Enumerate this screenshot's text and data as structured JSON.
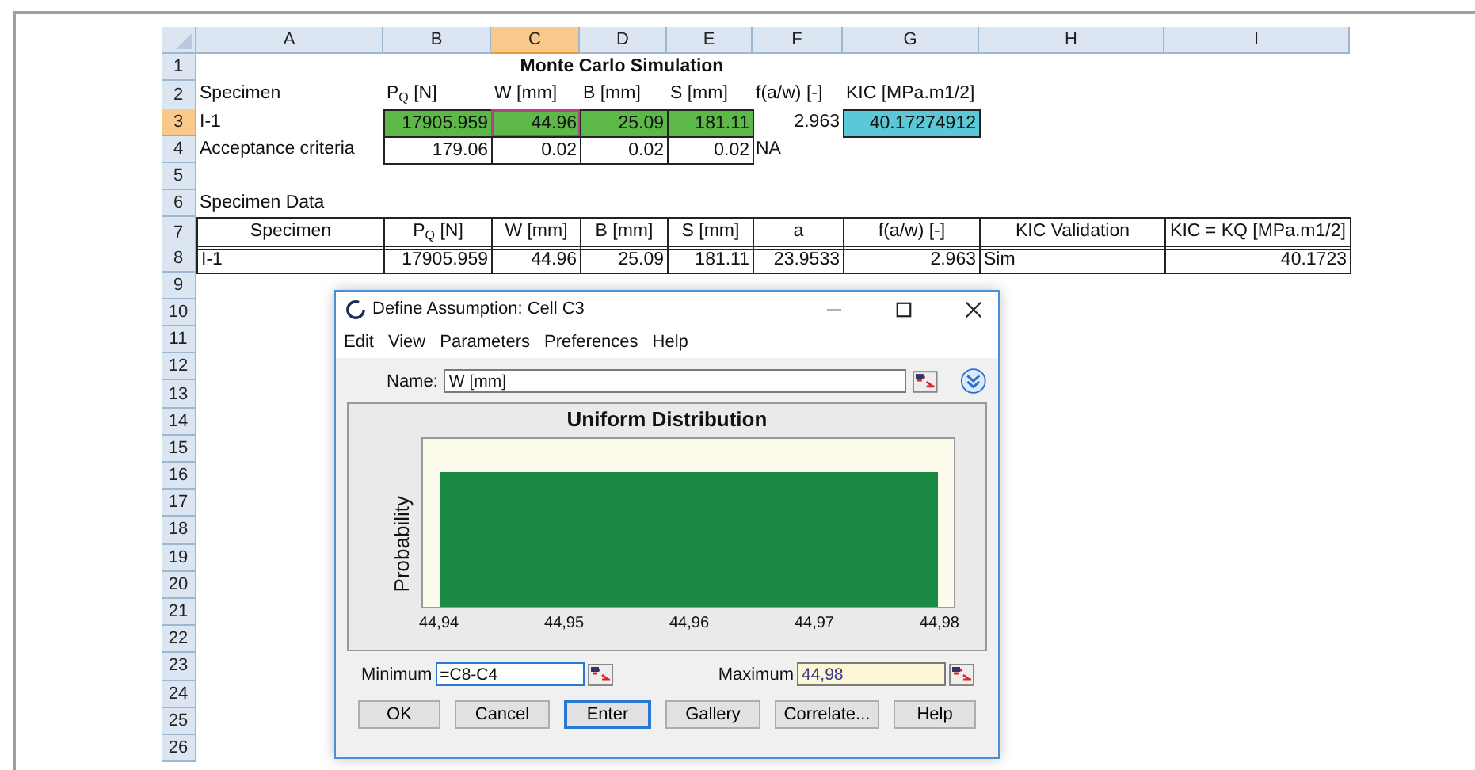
{
  "sheet": {
    "columns": [
      {
        "label": "A",
        "selected": false
      },
      {
        "label": "B",
        "selected": false
      },
      {
        "label": "C",
        "selected": true
      },
      {
        "label": "D",
        "selected": false
      },
      {
        "label": "E",
        "selected": false
      },
      {
        "label": "F",
        "selected": false
      },
      {
        "label": "G",
        "selected": false
      },
      {
        "label": "H",
        "selected": false
      },
      {
        "label": "I",
        "selected": false
      }
    ],
    "rows": [
      {
        "label": "1",
        "selected": false,
        "cells": [
          null,
          null,
          {
            "text": "Monte Carlo Simulation",
            "kind": "title"
          }
        ]
      },
      {
        "label": "2",
        "selected": false,
        "cells": [
          {
            "text": "Specimen",
            "kind": "text"
          },
          {
            "text": "P$_{Q}$ [N]",
            "kind": "text"
          },
          {
            "text": "W [mm]",
            "kind": "text"
          },
          {
            "text": "B [mm]",
            "kind": "text"
          },
          {
            "text": "S [mm]",
            "kind": "text"
          },
          {
            "text": "f(a/w) [-]",
            "kind": "text"
          },
          {
            "text": "KIC [MPa.m1/2]",
            "kind": "text"
          },
          null,
          null
        ]
      },
      {
        "label": "3",
        "selected": true,
        "cells": [
          {
            "text": "I-1",
            "kind": "text"
          },
          {
            "text": "17905.959",
            "kind": "number",
            "color": "#5cb947",
            "boxed": true
          },
          {
            "text": "44.96",
            "kind": "number",
            "color": "#5cb947",
            "boxed": true,
            "selected": true
          },
          {
            "text": "25.09",
            "kind": "number",
            "color": "#5cb947",
            "boxed": true
          },
          {
            "text": "181.11",
            "kind": "number",
            "color": "#5cb947",
            "boxed": true
          },
          {
            "text": "2.963",
            "kind": "number"
          },
          {
            "text": "40.17274912",
            "kind": "number",
            "color": "#5bc8d8",
            "boxed": true
          },
          null,
          null
        ]
      },
      {
        "label": "4",
        "selected": false,
        "cells": [
          {
            "text": "Acceptance criteria",
            "kind": "text"
          },
          {
            "text": "179.06",
            "kind": "number",
            "boxed": true
          },
          {
            "text": "0.02",
            "kind": "number",
            "boxed": true
          },
          {
            "text": "0.02",
            "kind": "number",
            "boxed": true
          },
          {
            "text": "0.02",
            "kind": "number",
            "boxed": true
          },
          {
            "text": "NA",
            "kind": "text"
          },
          null,
          null,
          null
        ]
      },
      {
        "label": "5",
        "selected": false,
        "cells": [
          null,
          null,
          null,
          null,
          null,
          null,
          null,
          null,
          null
        ]
      },
      {
        "label": "6",
        "selected": false,
        "cells": [
          {
            "text": "Specimen Data",
            "kind": "text"
          },
          null,
          null,
          null,
          null,
          null,
          null,
          null,
          null
        ]
      },
      {
        "label": "7",
        "selected": false,
        "cells": [
          {
            "text": "Specimen",
            "kind": "header",
            "boxed": true
          },
          {
            "text": "P$_{Q}$ [N]",
            "kind": "header",
            "boxed": true
          },
          {
            "text": "W [mm]",
            "kind": "header",
            "boxed": true
          },
          {
            "text": "B [mm]",
            "kind": "header",
            "boxed": true
          },
          {
            "text": "S [mm]",
            "kind": "header",
            "boxed": true
          },
          {
            "text": "a",
            "kind": "header",
            "boxed": true
          },
          {
            "text": "f(a/w) [-]",
            "kind": "header",
            "boxed": true
          },
          {
            "text": "KIC Validation",
            "kind": "header",
            "boxed": true
          },
          {
            "text": "KIC = KQ [MPa.m1/2]",
            "kind": "header",
            "boxed": true
          }
        ]
      },
      {
        "label": "8",
        "selected": false,
        "cells": [
          {
            "text": "I-1",
            "kind": "text",
            "boxed": true
          },
          {
            "text": "17905.959",
            "kind": "number",
            "boxed": true
          },
          {
            "text": "44.96",
            "kind": "number",
            "boxed": true
          },
          {
            "text": "25.09",
            "kind": "number",
            "boxed": true
          },
          {
            "text": "181.11",
            "kind": "number",
            "boxed": true
          },
          {
            "text": "23.9533",
            "kind": "number",
            "boxed": true
          },
          {
            "text": "2.963",
            "kind": "number",
            "boxed": true
          },
          {
            "text": "Sim",
            "kind": "text",
            "boxed": true
          },
          {
            "text": "40.1723",
            "kind": "number",
            "boxed": true
          }
        ]
      },
      {
        "label": "9",
        "selected": false,
        "cells": []
      },
      {
        "label": "10",
        "selected": false,
        "cells": []
      },
      {
        "label": "11",
        "selected": false,
        "cells": []
      },
      {
        "label": "12",
        "selected": false,
        "cells": []
      },
      {
        "label": "13",
        "selected": false,
        "cells": []
      },
      {
        "label": "14",
        "selected": false,
        "cells": []
      },
      {
        "label": "15",
        "selected": false,
        "cells": []
      },
      {
        "label": "16",
        "selected": false,
        "cells": []
      },
      {
        "label": "17",
        "selected": false,
        "cells": []
      },
      {
        "label": "18",
        "selected": false,
        "cells": []
      },
      {
        "label": "19",
        "selected": false,
        "cells": []
      },
      {
        "label": "20",
        "selected": false,
        "cells": []
      },
      {
        "label": "21",
        "selected": false,
        "cells": []
      },
      {
        "label": "22",
        "selected": false,
        "cells": []
      },
      {
        "label": "23",
        "selected": false,
        "cells": []
      },
      {
        "label": "24",
        "selected": false,
        "cells": []
      },
      {
        "label": "25",
        "selected": false,
        "cells": []
      },
      {
        "label": "26",
        "selected": false,
        "cells": []
      }
    ]
  },
  "dialog": {
    "title": "Define Assumption: Cell C3",
    "menu": [
      "Edit",
      "View",
      "Parameters",
      "Preferences",
      "Help"
    ],
    "name": {
      "label": "Name:",
      "value": "W [mm]"
    },
    "chart": {
      "title": "Uniform Distribution",
      "ylabel": "Probability",
      "xticks": [
        "44,94",
        "44,95",
        "44,96",
        "44,97",
        "44,98"
      ]
    },
    "minimum": {
      "label": "Minimum",
      "value": "=C8-C4",
      "focused": true,
      "highlighted": false
    },
    "maximum": {
      "label": "Maximum",
      "value": "44,98",
      "focused": false,
      "highlighted": true
    },
    "buttons": [
      {
        "label": "OK",
        "default": false
      },
      {
        "label": "Cancel",
        "default": false
      },
      {
        "label": "Enter",
        "default": true
      },
      {
        "label": "Gallery",
        "default": false
      },
      {
        "label": "Correlate...",
        "default": false
      },
      {
        "label": "Help",
        "default": false
      }
    ]
  }
}
